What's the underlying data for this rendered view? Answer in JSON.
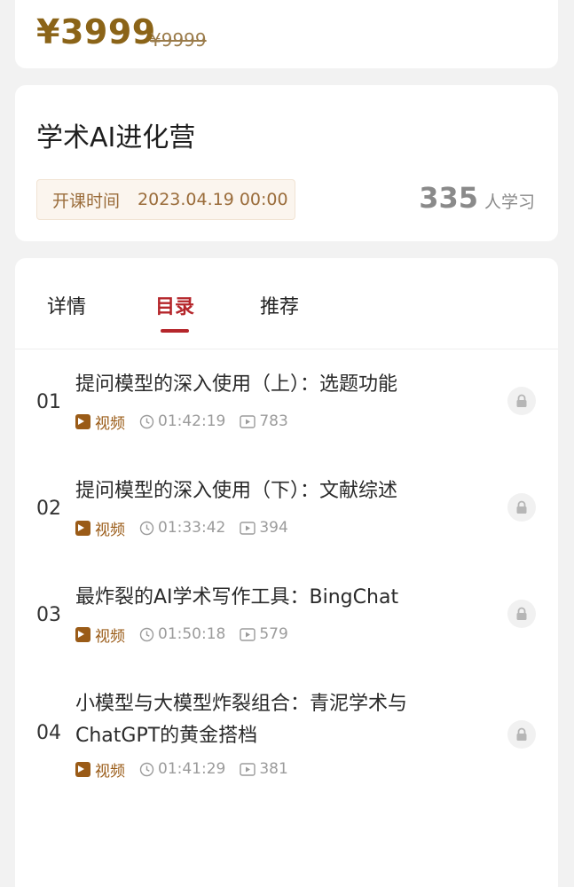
{
  "price": {
    "current": "¥3999",
    "original": "¥9999"
  },
  "course": {
    "title": "学术AI进化营",
    "start_label": "开课时间",
    "start_time": "2023.04.19 00:00",
    "learner_count": "335",
    "learner_unit": "人学习"
  },
  "tabs": [
    {
      "label": "详情",
      "active": false
    },
    {
      "label": "目录",
      "active": true
    },
    {
      "label": "推荐",
      "active": false
    }
  ],
  "lessons": [
    {
      "index": "01",
      "title": "提问模型的深入使用（上）：选题功能",
      "type": "视频",
      "duration": "01:42:19",
      "views": "783",
      "icon": "lock-icon"
    },
    {
      "index": "02",
      "title": "提问模型的深入使用（下）：文献综述",
      "type": "视频",
      "duration": "01:33:42",
      "views": "394",
      "icon": "lock-icon"
    },
    {
      "index": "03",
      "title": "最炸裂的AI学术写作工具：BingChat",
      "type": "视频",
      "duration": "01:50:18",
      "views": "579",
      "icon": "lock-icon"
    },
    {
      "index": "04",
      "title": "小模型与大模型炸裂组合：青泥学术与ChatGPT的黄金搭档",
      "type": "视频",
      "duration": "01:41:29",
      "views": "381",
      "icon": "lock-icon"
    }
  ],
  "colors": {
    "price": "#8b6418",
    "accent": "#b5262b",
    "video_tag": "#9a5b17",
    "muted": "#9b9b9b"
  }
}
